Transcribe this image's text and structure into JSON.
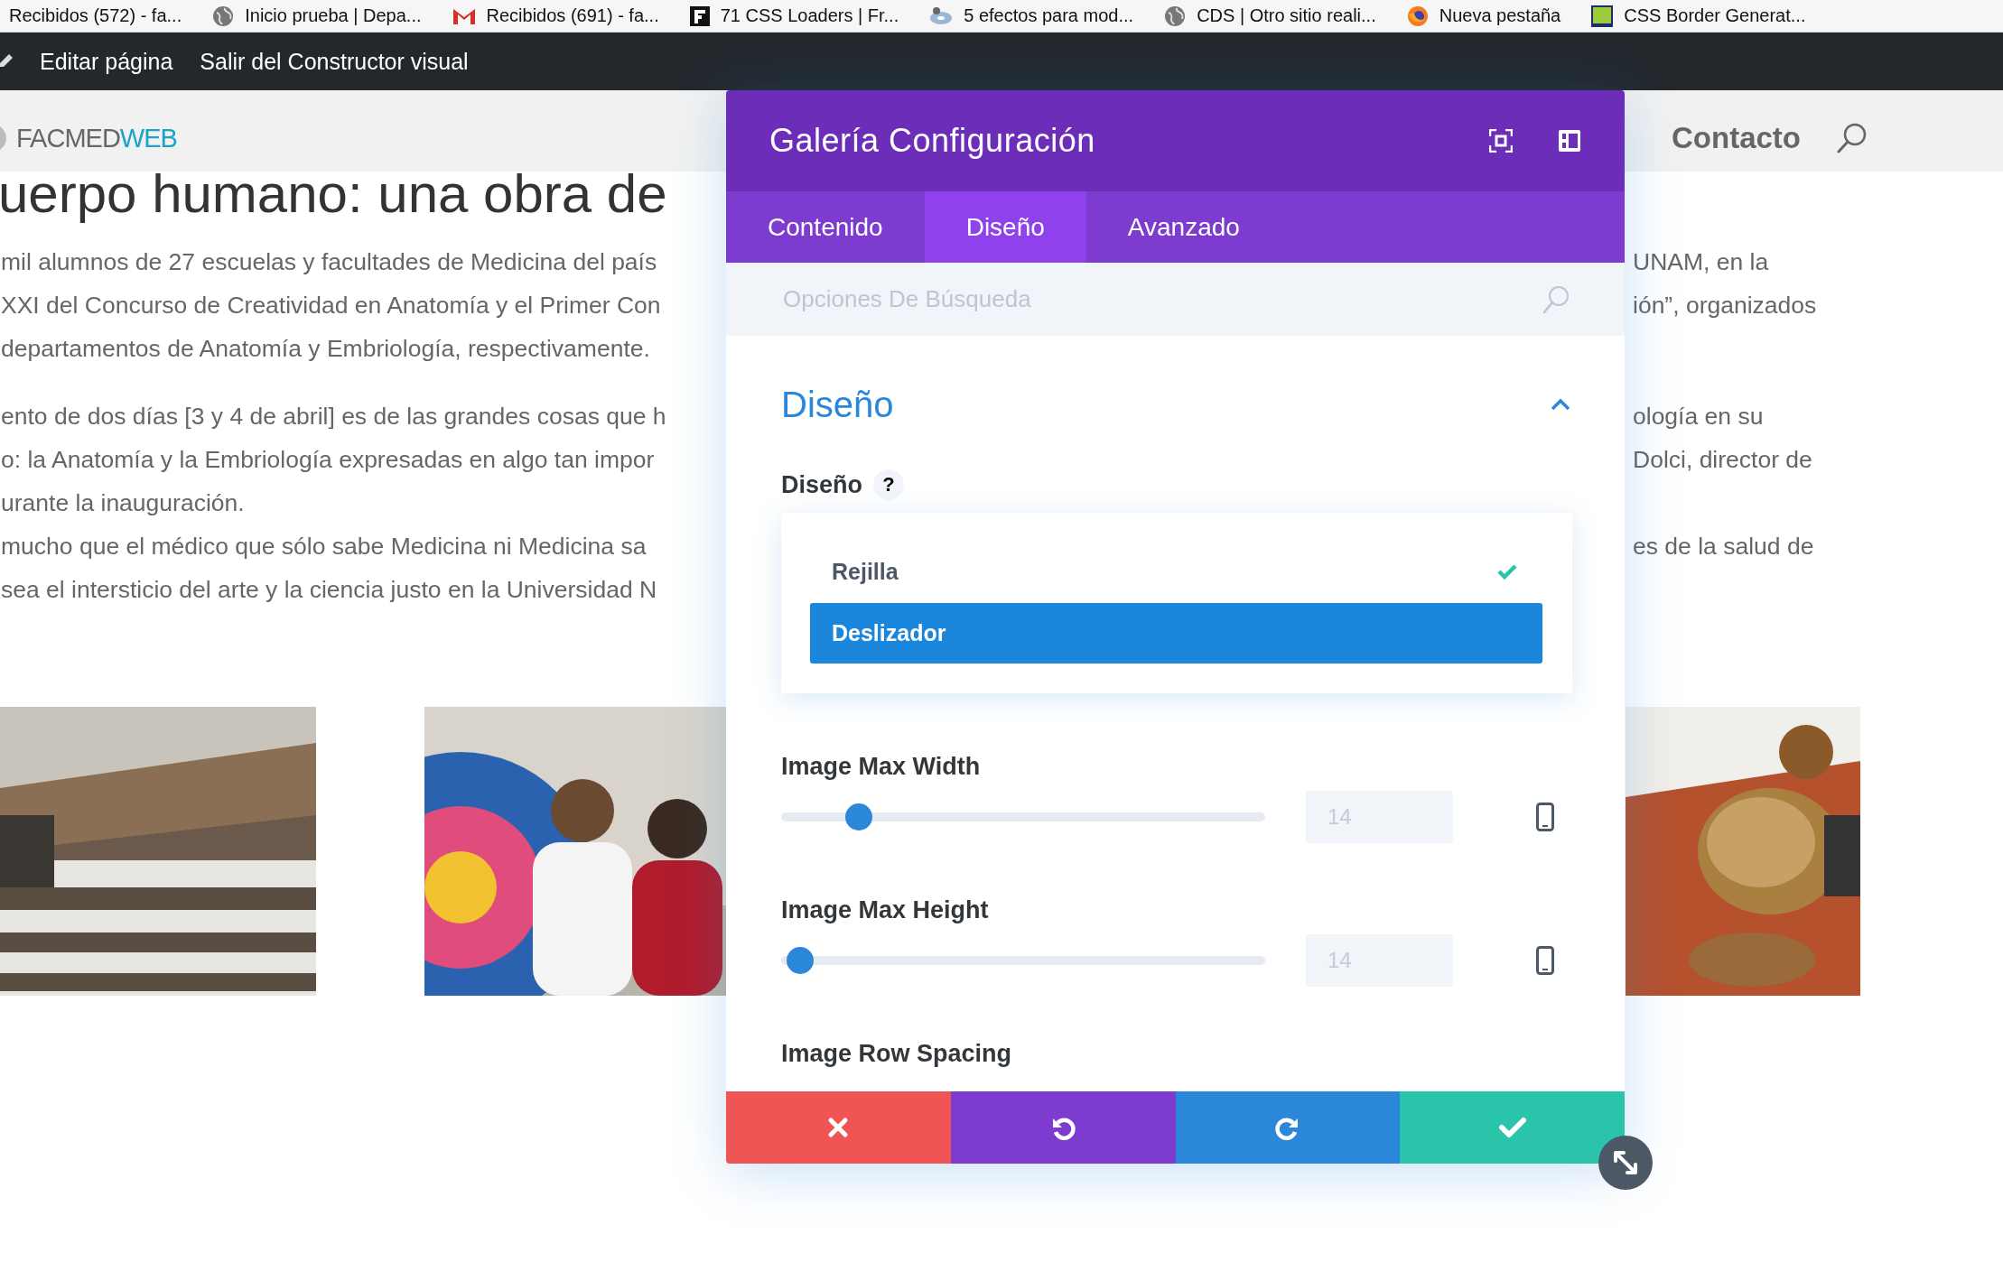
{
  "bookmarks": [
    {
      "label": "Recibidos (572) - fa..."
    },
    {
      "label": "Inicio prueba | Depa..."
    },
    {
      "label": "Recibidos (691) - fa..."
    },
    {
      "label": "71 CSS Loaders | Fr..."
    },
    {
      "label": "5 efectos para mod..."
    },
    {
      "label": "CDS | Otro sitio reali..."
    },
    {
      "label": "Nueva pestaña"
    },
    {
      "label": "CSS Border Generat..."
    }
  ],
  "admin_bar": {
    "items": [
      "Editar página",
      "Salir del Constructor visual"
    ]
  },
  "site_header": {
    "logo": {
      "first": "FACMED",
      "second": "WEB"
    },
    "nav": [
      "Contacto"
    ]
  },
  "article": {
    "heading": "uerpo humano: una obra de",
    "paragraphs": [
      [
        {
          "left": "mil alumnos de 27 escuelas y facultades de Medicina del país",
          "right": "UNAM, en la"
        },
        {
          "left": "XXI del Concurso de Creatividad en Anatomía y el Primer Con",
          "right": "ión”, organizados"
        },
        {
          "left": "departamentos de Anatomía y Embriología, respectivamente."
        }
      ],
      [
        {
          "left": "ento de dos días [3 y 4 de abril] es de las grandes cosas que h",
          "right": "ología en su"
        },
        {
          "left": "o: la Anatomía y la Embriología expresadas en algo tan impor",
          "right": "Dolci, director de"
        },
        {
          "left": "urante la inauguración."
        },
        {
          "left": "mucho que el médico que sólo sabe Medicina ni Medicina sa",
          "right": "es de la salud de"
        },
        {
          "left": "sea el intersticio del arte y la ciencia justo en la Universidad N"
        }
      ]
    ],
    "gallery": [
      {
        "kind": "picture"
      },
      {
        "kind": "picture"
      },
      {
        "kind": "picture"
      }
    ]
  },
  "modal": {
    "title": "Galería Configuración",
    "tabs": [
      {
        "label": "Contenido",
        "selected": false
      },
      {
        "label": "Diseño",
        "selected": true
      },
      {
        "label": "Avanzado",
        "selected": false
      }
    ],
    "search": {
      "placeholder": "Opciones De Búsqueda"
    },
    "section": {
      "title": "Diseño",
      "expanded": true,
      "layout_field": {
        "label": "Diseño",
        "help": "?",
        "options": [
          {
            "label": "Rejilla",
            "selected": true,
            "highlighted": false
          },
          {
            "label": "Deslizador",
            "selected": false,
            "highlighted": true
          }
        ]
      },
      "sliders": [
        {
          "label": "Image Max Width",
          "level": 0.16,
          "placeholder": "14"
        },
        {
          "label": "Image Max Height",
          "level": 0.04,
          "placeholder": "14"
        }
      ],
      "cut_label": "Image Row Spacing"
    },
    "footer": [
      {
        "kind": "discard"
      },
      {
        "kind": "undo"
      },
      {
        "kind": "redo"
      },
      {
        "kind": "save"
      }
    ]
  }
}
